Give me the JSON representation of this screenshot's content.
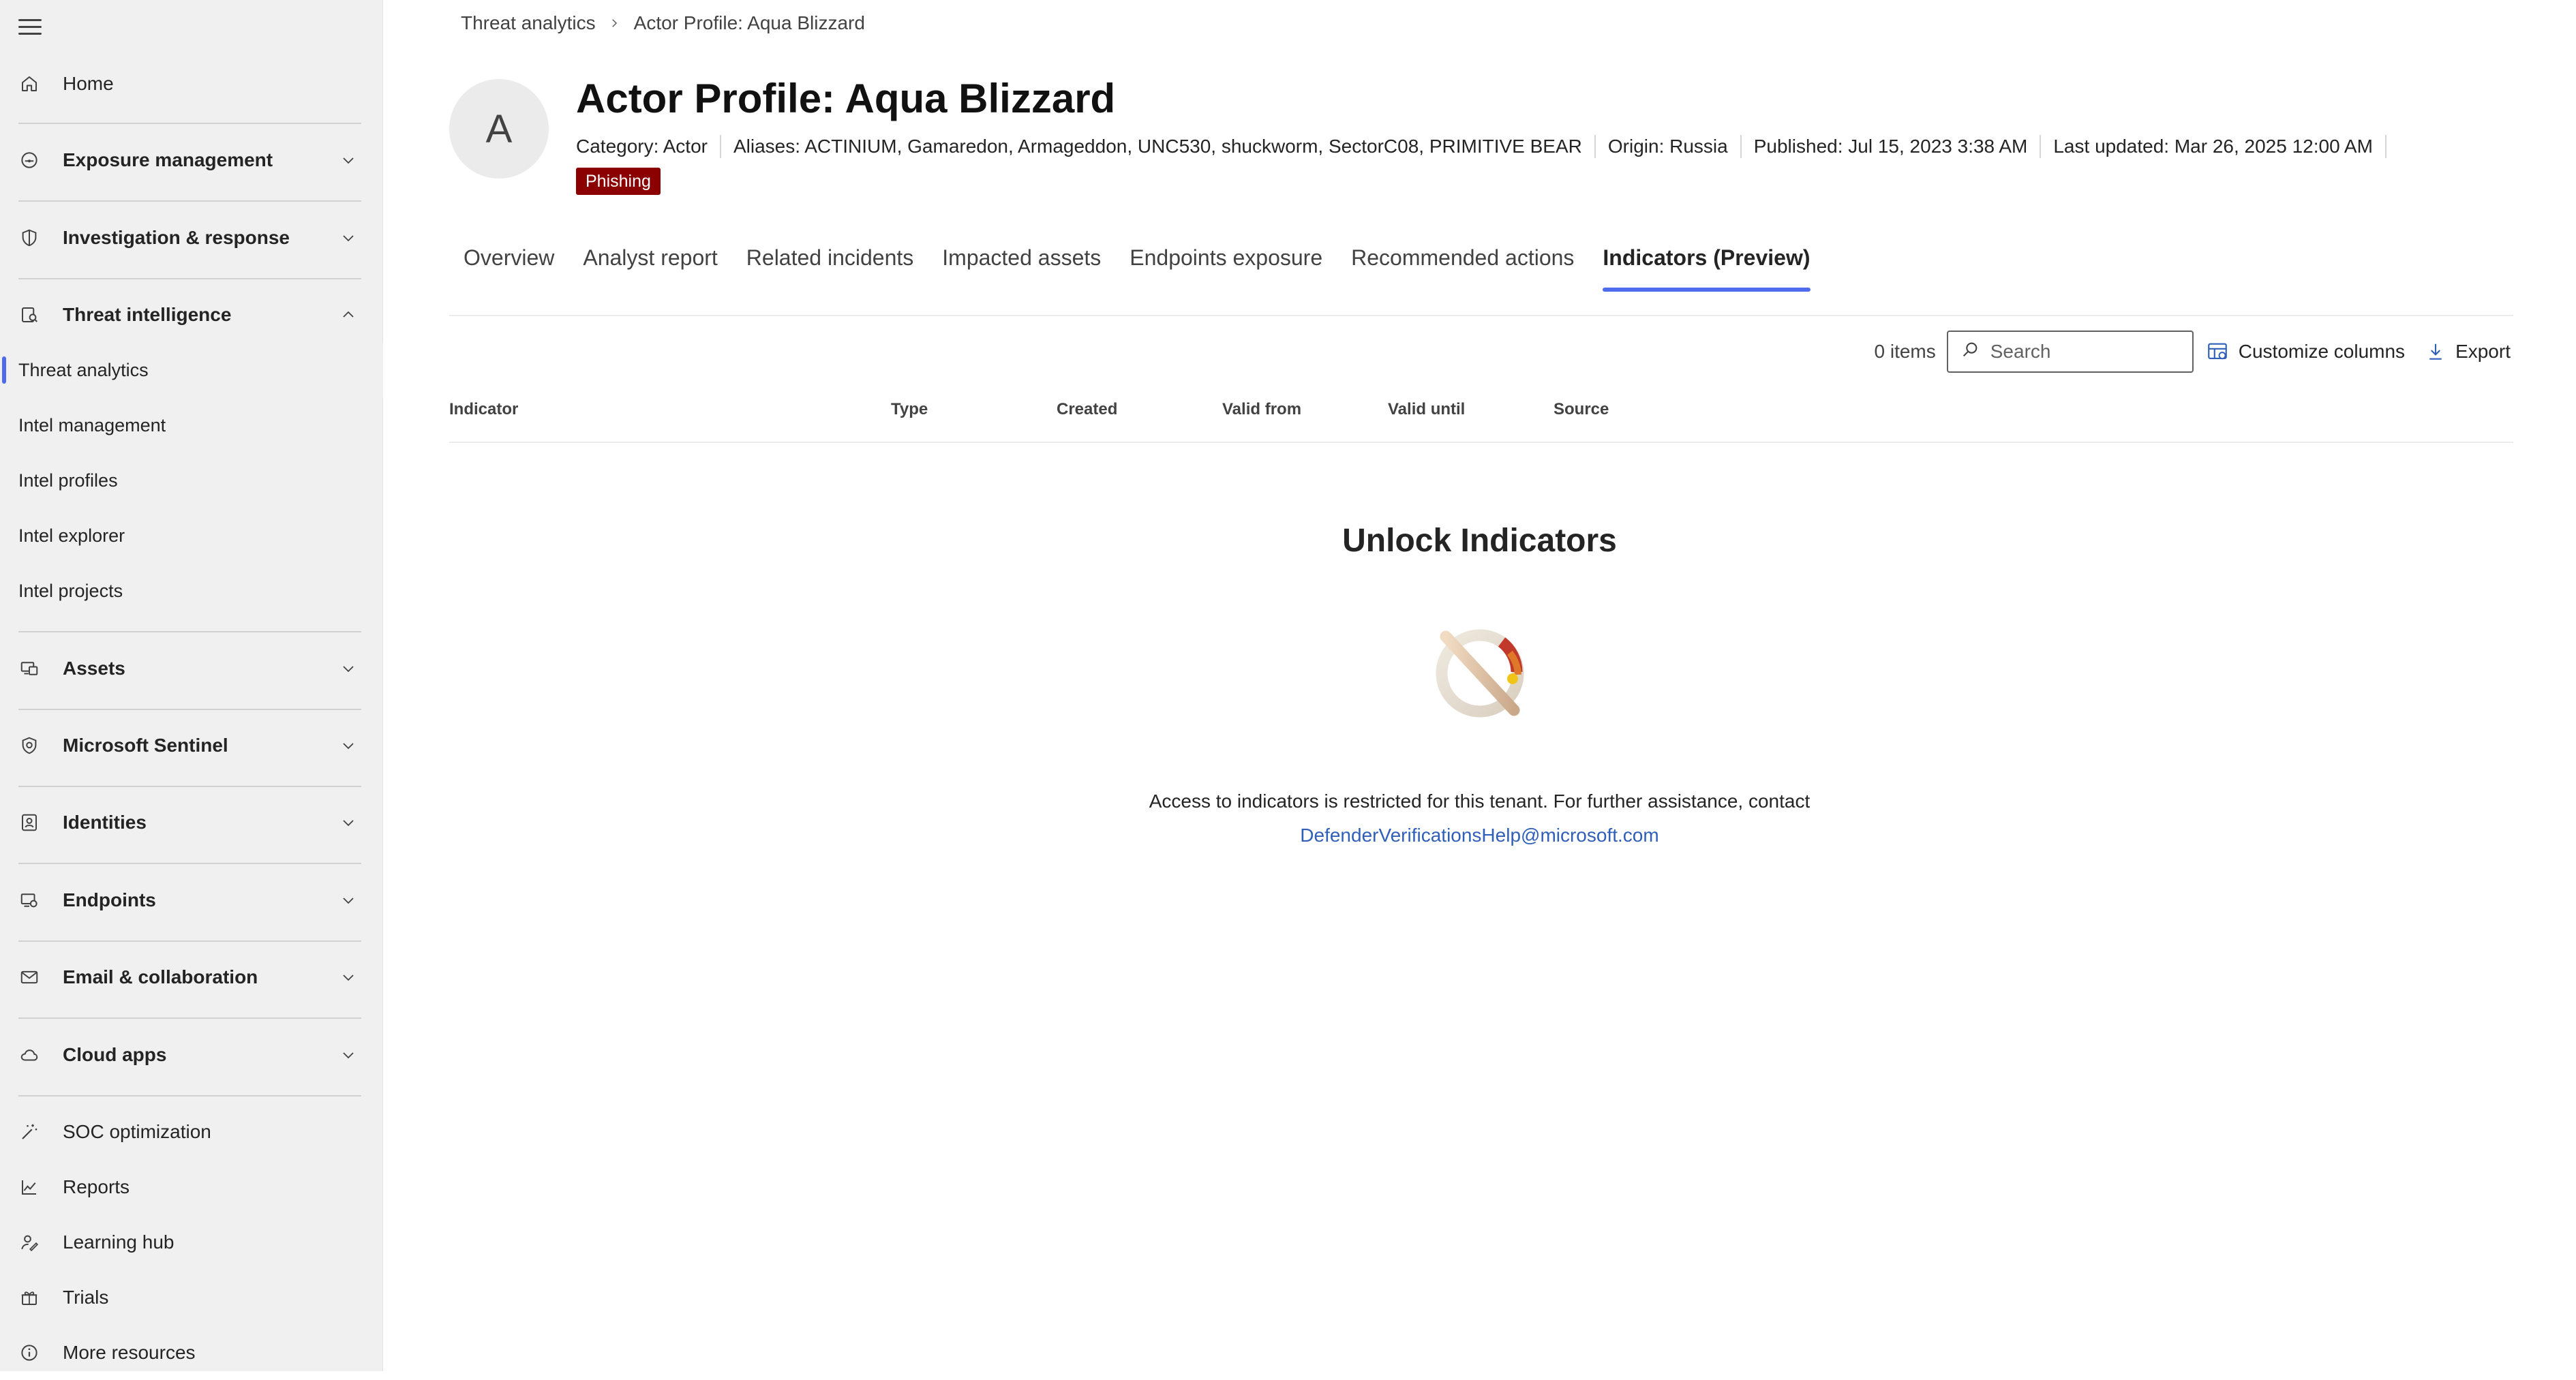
{
  "sidebar": {
    "home": "Home",
    "exposure": "Exposure management",
    "investigation": "Investigation & response",
    "threat_intel": "Threat intelligence",
    "threat_intel_items": [
      "Threat analytics",
      "Intel management",
      "Intel profiles",
      "Intel explorer",
      "Intel projects"
    ],
    "assets": "Assets",
    "sentinel": "Microsoft Sentinel",
    "identities": "Identities",
    "endpoints": "Endpoints",
    "email": "Email & collaboration",
    "cloud": "Cloud apps",
    "soc": "SOC optimization",
    "reports": "Reports",
    "learning": "Learning hub",
    "trials": "Trials",
    "more": "More resources"
  },
  "breadcrumb": {
    "parent": "Threat analytics",
    "current": "Actor Profile: Aqua Blizzard"
  },
  "profile": {
    "avatar_letter": "A",
    "title": "Actor Profile: Aqua Blizzard",
    "category": "Category: Actor",
    "aliases": "Aliases: ACTINIUM, Gamaredon, Armageddon, UNC530, shuckworm, SectorC08, PRIMITIVE BEAR",
    "origin": "Origin: Russia",
    "published": "Published: Jul 15, 2023 3:38 AM",
    "updated": "Last updated: Mar 26, 2025 12:00 AM",
    "tag": "Phishing",
    "tag_color": "#8b0000"
  },
  "tabs": [
    "Overview",
    "Analyst report",
    "Related incidents",
    "Impacted assets",
    "Endpoints exposure",
    "Recommended actions",
    "Indicators (Preview)"
  ],
  "active_tab": "Indicators (Preview)",
  "toolbar": {
    "items_count": "0 items",
    "search_placeholder": "Search",
    "customize": "Customize columns",
    "export": "Export"
  },
  "table": {
    "columns": [
      "Indicator",
      "Type",
      "Created",
      "Valid from",
      "Valid until",
      "Source"
    ]
  },
  "empty_state": {
    "title": "Unlock Indicators",
    "message": "Access to indicators is restricted for this tenant. For further assistance, contact",
    "link": "DefenderVerificationsHelp@microsoft.com"
  },
  "colors": {
    "accent": "#4f6bed",
    "link": "#2f5fb8",
    "sidebar_bg": "#f0f0f0"
  }
}
